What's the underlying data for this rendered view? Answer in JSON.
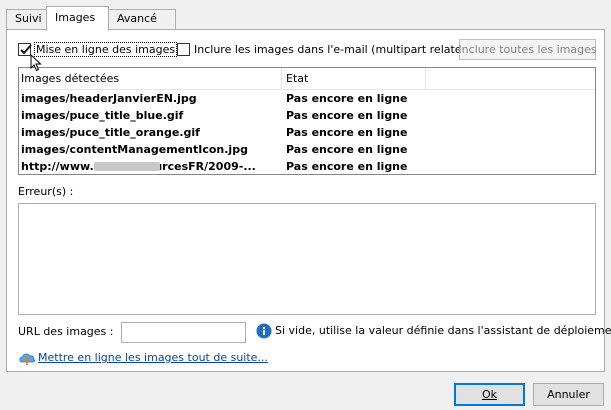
{
  "tabs": [
    {
      "label": "Suivi"
    },
    {
      "label": "Images"
    },
    {
      "label": "Avancé"
    }
  ],
  "options": {
    "upload_images_label": "Mise en ligne des images",
    "upload_images_checked": true,
    "multipart_label": "Inclure les images dans l'e-mail (multipart related)",
    "multipart_checked": false,
    "include_all_button": "Inclure toutes les images"
  },
  "images_list": {
    "columns": [
      "Images détectées",
      "Etat"
    ],
    "rows": [
      {
        "image": "images/headerJanvierEN.jpg",
        "status": "Pas encore en ligne"
      },
      {
        "image": "images/puce_title_blue.gif",
        "status": "Pas encore en ligne"
      },
      {
        "image": "images/puce_title_orange.gif",
        "status": "Pas encore en ligne"
      },
      {
        "image": "images/contentManagementIcon.jpg",
        "status": "Pas encore en ligne"
      },
      {
        "image_prefix": "http://www.",
        "image_suffix": ".com/resourcesFR/2009-...",
        "status": "Pas encore en ligne"
      }
    ]
  },
  "errors": {
    "label": "Erreur(s) :"
  },
  "url": {
    "label": "URL des images :",
    "value": "",
    "hint": "Si vide, utilise la valeur définie dans l'assistant de déploiement."
  },
  "upload_now_link": "Mettre en ligne les images tout de suite...",
  "footer": {
    "ok_label": "Ok",
    "cancel_label": "Annuler"
  },
  "colors": {
    "link": "#0645ad",
    "default_button_border": "#0078d7",
    "info_icon": "#1e6fc4"
  }
}
